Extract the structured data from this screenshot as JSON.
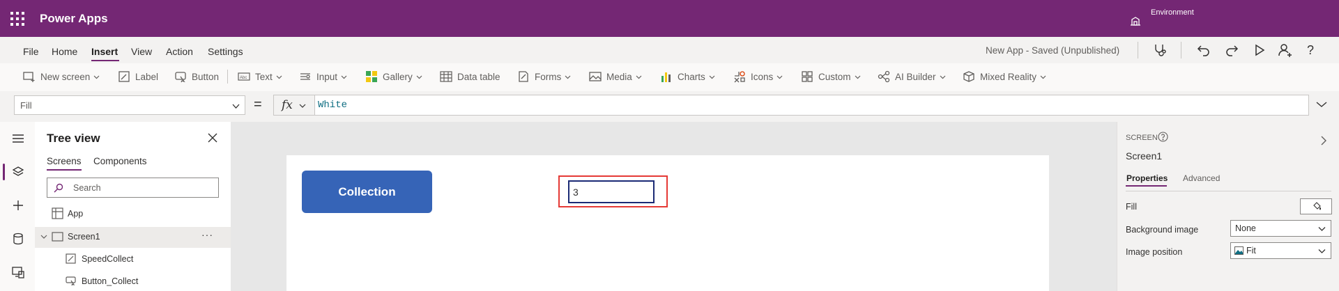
{
  "app": {
    "name": "Power Apps",
    "environment_label": "Environment"
  },
  "menu": {
    "items": [
      "File",
      "Home",
      "Insert",
      "View",
      "Action",
      "Settings"
    ],
    "active": "Insert",
    "status": "New App - Saved (Unpublished)"
  },
  "toolbar": {
    "new_screen": "New screen",
    "label": "Label",
    "button": "Button",
    "text": "Text",
    "input": "Input",
    "gallery": "Gallery",
    "data_table": "Data table",
    "forms": "Forms",
    "media": "Media",
    "charts": "Charts",
    "icons": "Icons",
    "custom": "Custom",
    "ai_builder": "AI Builder",
    "mixed_reality": "Mixed Reality"
  },
  "formula_bar": {
    "property": "Fill",
    "equals": "=",
    "fx": "fx",
    "formula": "White"
  },
  "tree_view": {
    "title": "Tree view",
    "tabs": [
      "Screens",
      "Components"
    ],
    "active_tab": "Screens",
    "search_placeholder": "Search",
    "items": {
      "app": "App",
      "screen": "Screen1",
      "ellipsis": "···",
      "control1": "SpeedCollect",
      "control2": "Button_Collect"
    }
  },
  "canvas": {
    "button_label": "Collection",
    "input_value": "3"
  },
  "properties_pane": {
    "kind": "SCREEN",
    "name": "Screen1",
    "tabs": [
      "Properties",
      "Advanced"
    ],
    "active_tab": "Properties",
    "fill_label": "Fill",
    "fill_color": "#ffffff",
    "background_image_label": "Background image",
    "background_image_value": "None",
    "image_position_label": "Image position",
    "image_position_value": "Fit"
  },
  "colors": {
    "brand": "#742774",
    "button": "#3664b7",
    "highlight": "#e53935",
    "formula_text": "#0f6e82"
  }
}
